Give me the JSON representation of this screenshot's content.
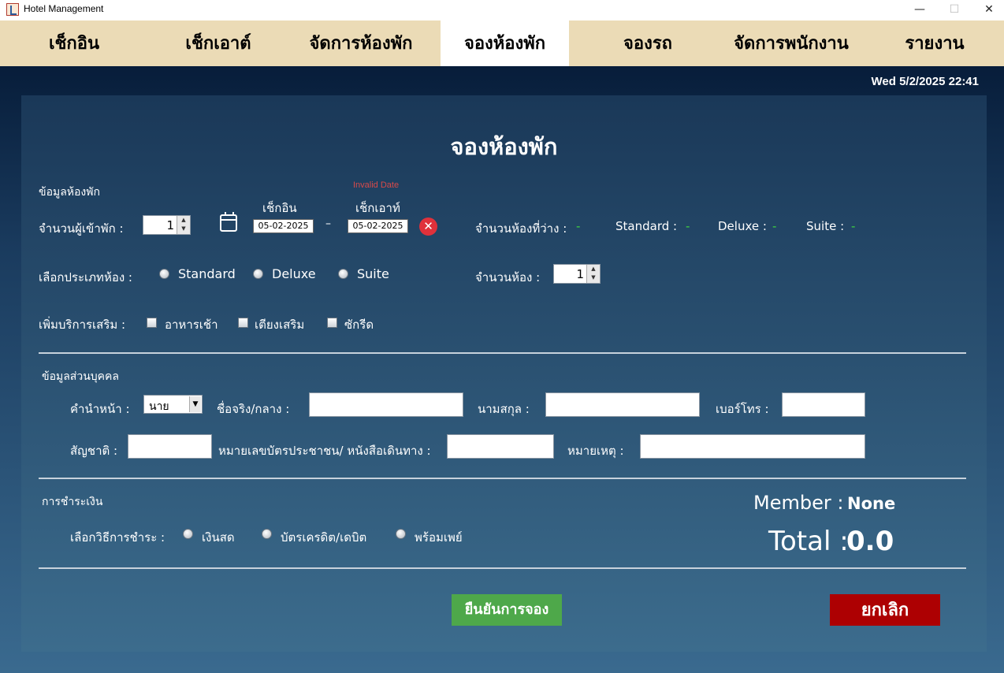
{
  "window": {
    "title": "Hotel Management",
    "min": "—",
    "max": "☐",
    "close": "✕"
  },
  "nav": {
    "tabs": [
      {
        "label": "เช็กอิน"
      },
      {
        "label": "เช็กเอาต์"
      },
      {
        "label": "จัดการห้องพัก"
      },
      {
        "label": "จองห้องพัก",
        "active": true
      },
      {
        "label": "จองรถ"
      },
      {
        "label": "จัดการพนักงาน"
      },
      {
        "label": "รายงาน"
      }
    ]
  },
  "datetime": "Wed 5/2/2025 22:41",
  "page_title": "จองห้องพัก",
  "room_info": {
    "section_label": "ข้อมูลห้องพัก",
    "guests_label": "จำนวนผู้เข้าพัก :",
    "guests_value": "1",
    "checkin_label": "เช็กอิน",
    "checkin_value": "05-02-2025",
    "separator": "–",
    "checkout_label": "เช็กเอาท์",
    "checkout_value": "05-02-2025",
    "invalid_date": "Invalid Date",
    "available_label": "จำนวนห้องที่ว่าง :",
    "available_value": "-",
    "standard_label": "Standard :",
    "standard_value": "-",
    "deluxe_label": "Deluxe :",
    "deluxe_value": "-",
    "suite_label": "Suite :",
    "suite_value": "-",
    "room_type_label": "เลือกประเภทห้อง :",
    "room_types": [
      "Standard",
      "Deluxe",
      "Suite"
    ],
    "rooms_label": "จำนวนห้อง :",
    "rooms_value": "1",
    "extras_label": "เพิ่มบริการเสริม :",
    "extras": [
      "อาหารเช้า",
      "เตียงเสริม",
      "ซักรีด"
    ]
  },
  "personal": {
    "section_label": "ข้อมูลส่วนบุคคล",
    "prefix_label": "คำนำหน้า :",
    "prefix_value": "นาย",
    "firstname_label": "ชื่อจริง/กลาง :",
    "lastname_label": "นามสกุล :",
    "phone_label": "เบอร์โทร :",
    "nationality_label": "สัญชาติ :",
    "id_label": "หมายเลขบัตรประชาชน/ หนังสือเดินทาง :",
    "note_label": "หมายเหตุ :"
  },
  "payment": {
    "section_label": "การชำระเงิน",
    "method_label": "เลือกวิธีการชำระ :",
    "methods": [
      "เงินสด",
      "บัตรเครดิต/เดบิต",
      "พร้อมเพย์"
    ],
    "member_label": "Member :",
    "member_value": "None",
    "total_label": "Total :",
    "total_value": "0.0"
  },
  "buttons": {
    "confirm": "ยืนยันการจอง",
    "cancel": "ยกเลิก"
  }
}
